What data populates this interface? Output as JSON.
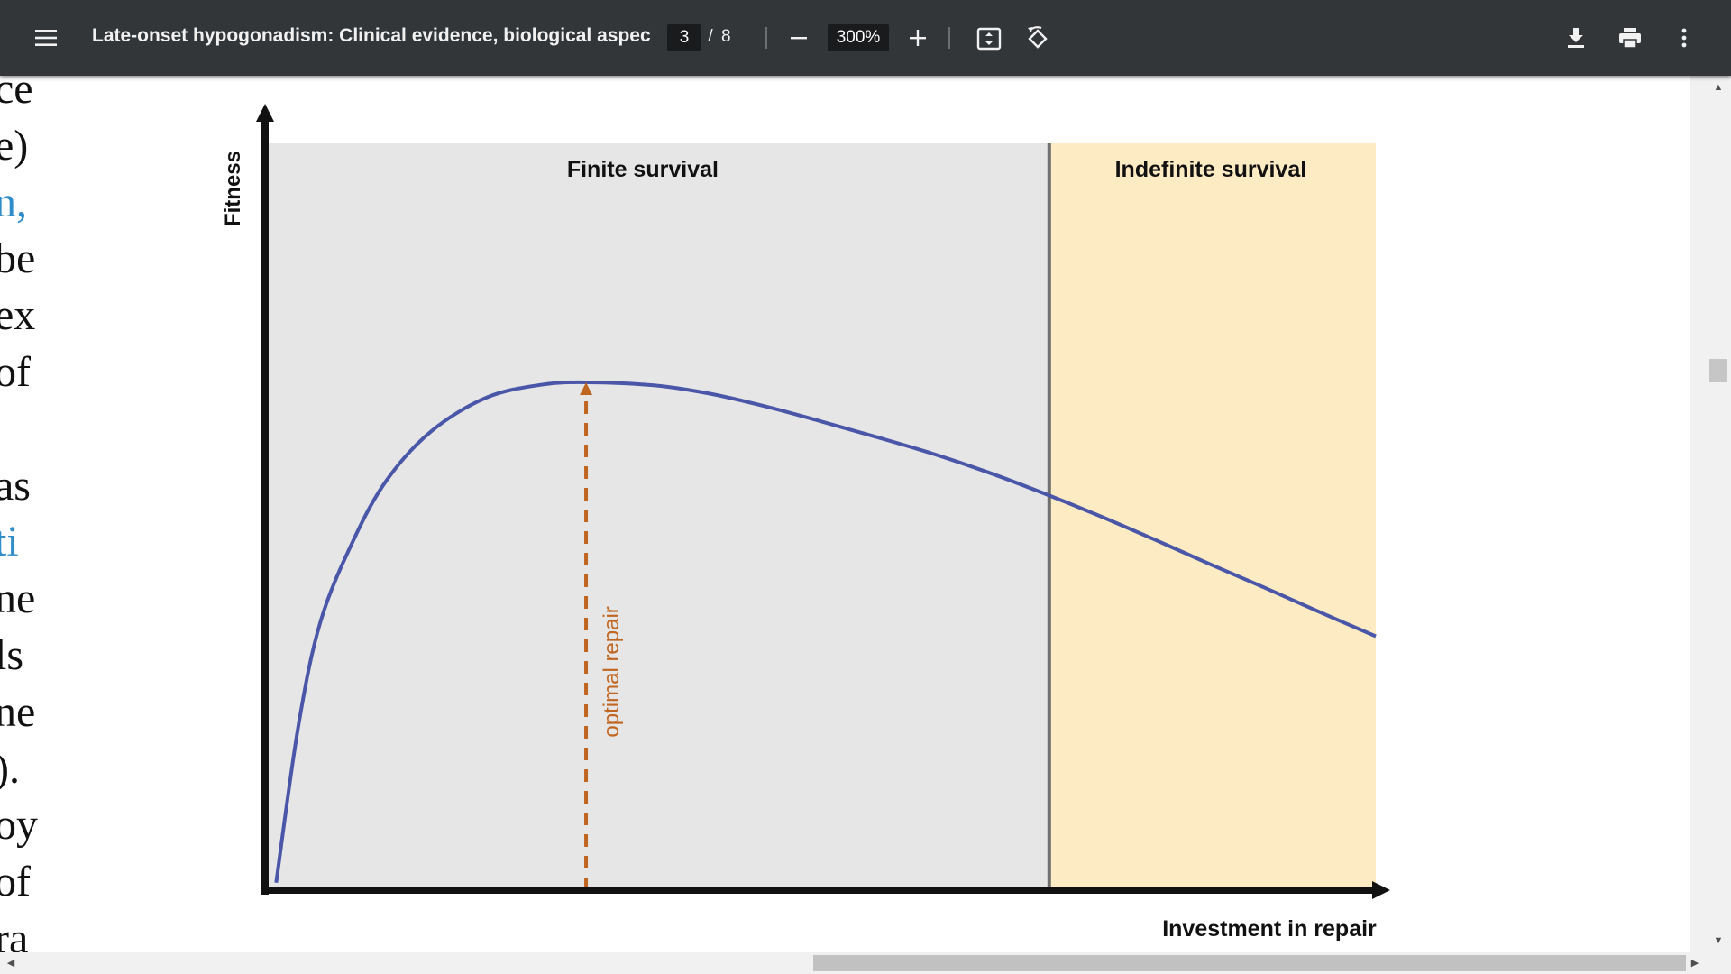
{
  "toolbar": {
    "title": "Late-onset hypogonadism: Clinical evidence, biological aspects...",
    "current_page": "3",
    "page_separator": "/",
    "total_pages": "8",
    "zoom": "300%",
    "icons": {
      "menu": "menu-icon",
      "zoom_out": "minus-icon",
      "zoom_in": "plus-icon",
      "fit": "fit-to-page-icon",
      "rotate": "rotate-counterclockwise-icon",
      "download": "download-icon",
      "print": "print-icon",
      "more": "more-vert-icon"
    }
  },
  "page_left_text": [
    "ce",
    "e)",
    "n,",
    "be",
    "ex",
    "of",
    "",
    "as",
    "ti",
    "ne",
    "ls",
    "ne",
    ").",
    "oy",
    "of",
    "ra"
  ],
  "page_left_text_link_lines": [
    2,
    8
  ],
  "colors": {
    "finite_region": "#e6e6e6",
    "indefinite_region": "#fdebc3",
    "curve": "#4a56a8",
    "optimal_arrow": "#c0651f",
    "divider": "#6f6f6f",
    "link_text": "#2f8ec9"
  },
  "chart_data": {
    "type": "line",
    "title": "",
    "xlabel": "Investment in repair",
    "ylabel": "Fitness",
    "regions": [
      {
        "label": "Finite survival",
        "x_range": [
          0,
          0.706
        ]
      },
      {
        "label": "Indefinite survival",
        "x_range": [
          0.706,
          1.0
        ]
      }
    ],
    "annotation": {
      "label": "optimal repair",
      "x": 0.289,
      "y": 0.68
    },
    "series": [
      {
        "x": [
          0.01,
          0.03,
          0.05,
          0.08,
          0.11,
          0.15,
          0.2,
          0.25,
          0.29,
          0.35,
          0.4,
          0.45,
          0.5,
          0.55,
          0.6,
          0.65,
          0.7,
          0.75,
          0.8,
          0.85,
          0.9,
          0.95,
          1.0
        ],
        "y": [
          0.01,
          0.22,
          0.36,
          0.47,
          0.55,
          0.615,
          0.66,
          0.677,
          0.68,
          0.676,
          0.665,
          0.648,
          0.628,
          0.607,
          0.585,
          0.56,
          0.532,
          0.502,
          0.47,
          0.437,
          0.405,
          0.372,
          0.34
        ]
      }
    ],
    "xlim": [
      0,
      1
    ],
    "ylim": [
      0,
      1
    ],
    "grid": false,
    "legend": "none"
  }
}
